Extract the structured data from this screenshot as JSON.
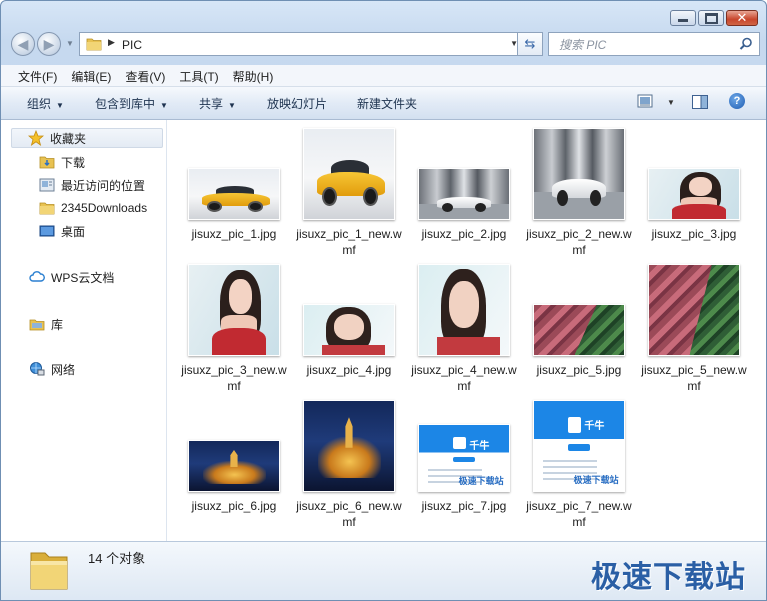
{
  "window": {
    "controls": {
      "minimize": "minimize",
      "maximize": "maximize",
      "close": "close"
    }
  },
  "navigation": {
    "path_segment": "PIC",
    "search_placeholder": "搜索 PIC"
  },
  "menu": [
    {
      "label": "文件(F)"
    },
    {
      "label": "编辑(E)"
    },
    {
      "label": "查看(V)"
    },
    {
      "label": "工具(T)"
    },
    {
      "label": "帮助(H)"
    }
  ],
  "toolbar": {
    "organize": "组织",
    "include_in_library": "包含到库中",
    "share": "共享",
    "slideshow": "放映幻灯片",
    "new_folder": "新建文件夹"
  },
  "sidebar": {
    "favorites": "收藏夹",
    "items": [
      {
        "label": "下载",
        "icon": "download-folder-icon"
      },
      {
        "label": "最近访问的位置",
        "icon": "recent-places-icon"
      },
      {
        "label": "2345Downloads",
        "icon": "folder-icon"
      },
      {
        "label": "桌面",
        "icon": "desktop-icon"
      }
    ],
    "wps": "WPS云文档",
    "libraries": "库",
    "network": "网络"
  },
  "files": [
    {
      "name": "jisuxz_pic_1.jpg",
      "art": "car-yellow"
    },
    {
      "name": "jisuxz_pic_1_new.wmf",
      "art": "car-yellow"
    },
    {
      "name": "jisuxz_pic_2.jpg",
      "art": "car-white"
    },
    {
      "name": "jisuxz_pic_2_new.wmf",
      "art": "car-white"
    },
    {
      "name": "jisuxz_pic_3.jpg",
      "art": "portrait"
    },
    {
      "name": "jisuxz_pic_3_new.wmf",
      "art": "portrait"
    },
    {
      "name": "jisuxz_pic_4.jpg",
      "art": "portrait2"
    },
    {
      "name": "jisuxz_pic_4_new.wmf",
      "art": "portrait2"
    },
    {
      "name": "jisuxz_pic_5.jpg",
      "art": "tulips"
    },
    {
      "name": "jisuxz_pic_5_new.wmf",
      "art": "tulips"
    },
    {
      "name": "jisuxz_pic_6.jpg",
      "art": "castle"
    },
    {
      "name": "jisuxz_pic_6_new.wmf",
      "art": "castle"
    },
    {
      "name": "jisuxz_pic_7.jpg",
      "art": "app-shot"
    },
    {
      "name": "jisuxz_pic_7_new.wmf",
      "art": "app-shot"
    }
  ],
  "details": {
    "count_text": "14 个对象"
  },
  "watermark": "极速下载站",
  "colors": {
    "accent": "#2a5fa5",
    "window_frame": "#c6d9ef",
    "close_button": "#c8462c"
  }
}
